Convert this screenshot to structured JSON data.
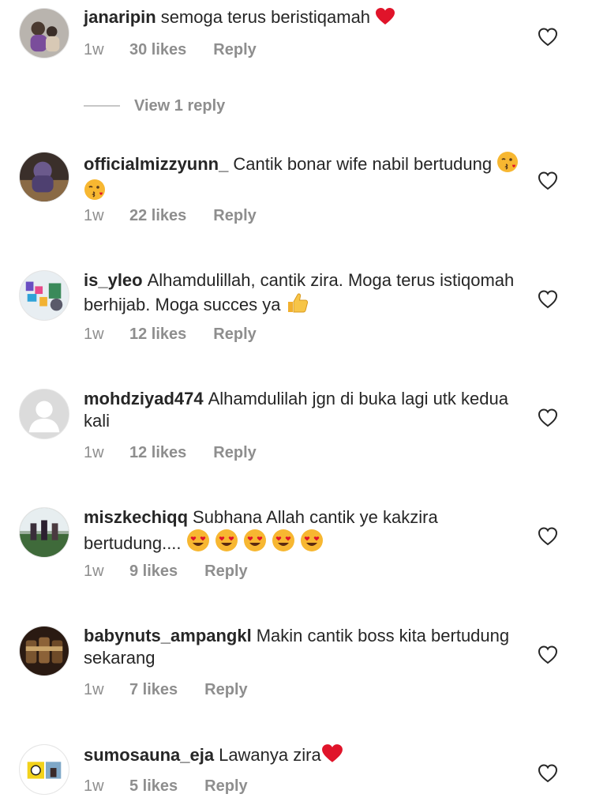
{
  "comments": [
    {
      "username": "janaripin",
      "text": "semoga terus beristiqamah",
      "emojis": [
        "red-heart"
      ],
      "age": "1w",
      "likes": "30 likes",
      "reply": "Reply"
    },
    {
      "username": "officialmizzyunn_",
      "text": "Cantik bonar wife nabil bertudung",
      "emojis": [
        "kissing-face",
        "kissing-face"
      ],
      "age": "1w",
      "likes": "22 likes",
      "reply": "Reply"
    },
    {
      "username": "is_yleo",
      "text": "Alhamdulillah, cantik zira. Moga terus istiqomah berhijab. Moga succes ya",
      "emojis": [
        "thumbs-up"
      ],
      "age": "1w",
      "likes": "12 likes",
      "reply": "Reply"
    },
    {
      "username": "mohdziyad474",
      "text": "Alhamdulilah jgn di buka lagi utk kedua kali",
      "emojis": [],
      "age": "1w",
      "likes": "12 likes",
      "reply": "Reply"
    },
    {
      "username": "miszkechiqq",
      "text": "Subhana Allah cantik ye kakzira bertudung....",
      "emojis": [
        "heart-eyes",
        "heart-eyes",
        "heart-eyes",
        "heart-eyes",
        "heart-eyes"
      ],
      "age": "1w",
      "likes": "9 likes",
      "reply": "Reply"
    },
    {
      "username": "babynuts_ampangkl",
      "text": "Makin cantik boss kita bertudung sekarang",
      "emojis": [],
      "age": "1w",
      "likes": "7 likes",
      "reply": "Reply"
    },
    {
      "username": "sumosauna_eja",
      "text": "Lawanya zira",
      "emojis": [
        "red-heart"
      ],
      "age": "1w",
      "likes": "5 likes",
      "reply": "Reply"
    }
  ],
  "view_replies": "View 1 reply",
  "colors": {
    "text": "#262626",
    "muted": "#8e8e8e",
    "heart_emoji": "#e0142a"
  }
}
